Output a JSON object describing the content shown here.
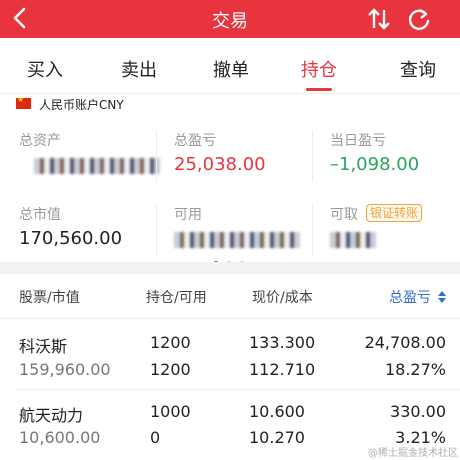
{
  "header": {
    "title": "交易"
  },
  "tabs": [
    {
      "label": "买入"
    },
    {
      "label": "卖出"
    },
    {
      "label": "撤单"
    },
    {
      "label": "持仓",
      "active": true
    },
    {
      "label": "查询"
    }
  ],
  "account": {
    "label": "人民币账户CNY"
  },
  "summary": {
    "total_assets_label": "总资产",
    "total_pnl_label": "总盈亏",
    "total_pnl_value": "25,038.00",
    "today_pnl_label": "当日盈亏",
    "today_pnl_value": "–1,098.00",
    "market_value_label": "总市值",
    "market_value": "170,560.00",
    "available_label": "可用",
    "withdrawable_label": "可取",
    "bank_transfer_label": "银证转账"
  },
  "colors": {
    "accent": "#e8343e",
    "down": "#2aa55f",
    "link": "#2e6fd8",
    "badge": "#f2a23a"
  },
  "positions_table": {
    "headers": {
      "stock": "股票/市值",
      "holdings": "持仓/可用",
      "price": "现价/成本",
      "pnl": "总盈亏"
    },
    "rows": [
      {
        "name": "科沃斯",
        "market_value": "159,960.00",
        "holding": "1200",
        "available": "1200",
        "price": "133.300",
        "cost": "112.710",
        "pnl": "24,708.00",
        "pnl_pct": "18.27%"
      },
      {
        "name": "航天动力",
        "market_value": "10,600.00",
        "holding": "1000",
        "available": "0",
        "price": "10.600",
        "cost": "10.270",
        "pnl": "330.00",
        "pnl_pct": "3.21%"
      }
    ]
  },
  "watermark": "@稀土掘金技术社区"
}
